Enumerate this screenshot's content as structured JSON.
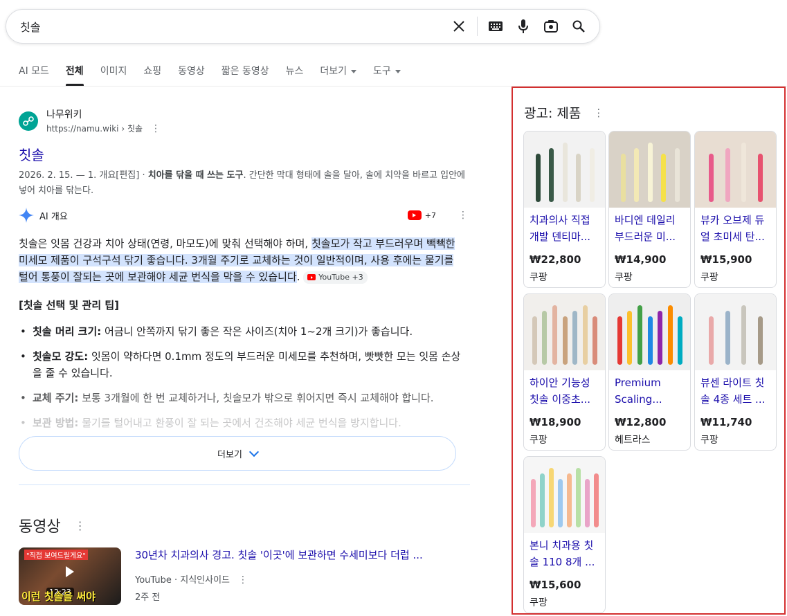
{
  "search": {
    "query": "칫솔",
    "icons": [
      "close-icon",
      "keyboard-icon",
      "mic-icon",
      "lens-icon",
      "search-icon"
    ]
  },
  "tabs": [
    {
      "label": "AI 모드",
      "active": false
    },
    {
      "label": "전체",
      "active": true
    },
    {
      "label": "이미지",
      "active": false
    },
    {
      "label": "쇼핑",
      "active": false
    },
    {
      "label": "동영상",
      "active": false
    },
    {
      "label": "짧은 동영상",
      "active": false
    },
    {
      "label": "뉴스",
      "active": false
    },
    {
      "label": "더보기",
      "active": false,
      "dropdown": true
    },
    {
      "label": "도구",
      "active": false,
      "dropdown": true
    }
  ],
  "result": {
    "site_name": "나무위키",
    "site_url": "https://namu.wiki › 칫솔",
    "title": "칫솔",
    "snippet_date": "2026. 2. 15. — 1. 개요[편집] · ",
    "snippet_bold": "치아를 닦을 때 쓰는 도구",
    "snippet_rest": ". 간단한 막대 형태에 솔을 달아, 솔에 치약을 바르고 입안에 넣어 치아를 닦는다."
  },
  "ai_overview": {
    "label": "AI 개요",
    "source_count": "+7",
    "intro": "칫솔은 잇몸 건강과 치아 상태(연령, 마모도)에 맞춰 선택해야 하며, ",
    "highlight": "칫솔모가 작고 부드러우며 빽빽한 미세모 제품이 구석구석 닦기 좋습니다. 3개월 주기로 교체하는 것이 일반적이며, 사용 후에는 물기를 털어 통풍이 잘되는 곳에 보관해야 세균 번식을 막을 수 있습니다",
    "trail": ".",
    "cite": "YouTube +3",
    "tips_title": "[칫솔 선택 및 관리 팁]",
    "tips": [
      {
        "bold": "칫솔 머리 크기:",
        "text": " 어금니 안쪽까지 닦기 좋은 작은 사이즈(치아 1~2개 크기)가 좋습니다."
      },
      {
        "bold": "칫솔모 강도:",
        "text": " 잇몸이 약하다면 0.1mm 정도의 부드러운 미세모를 추천하며, 빳빳한 모는 잇몸 손상을 줄 수 있습니다."
      },
      {
        "bold": "교체 주기:",
        "text": " 보통 3개월에 한 번 교체하거나, 칫솔모가 밖으로 휘어지면 즉시 교체해야 합니다."
      },
      {
        "bold": "보관 방법:",
        "text": " 물기를 털어내고 환풍이 잘 되는 곳에서 건조해야 세균 번식을 방지합니다."
      }
    ],
    "more_label": "더보기"
  },
  "videos": {
    "heading": "동영상",
    "items": [
      {
        "title": "30년차 치과의사 경고. 칫솔 '이곳'에 보관하면 수세미보다 더럽 ...",
        "source": "YouTube · 지식인사이드",
        "age": "2주 전",
        "duration": "12:23",
        "thumb_top": "\"직접 보여드릴게요\"",
        "thumb_bottom": "이런 칫솔을 써야"
      }
    ]
  },
  "ads": {
    "title": "광고: 제품",
    "products": [
      {
        "name": "치과의사 직접 개발 덴티마...",
        "price": "₩22,800",
        "seller": "쿠팡",
        "bg": "#f2f2f2",
        "colors": [
          "#2e4a3a",
          "#3a5a48",
          "#e9e6dc",
          "#d9d4c6",
          "#f0ede4"
        ]
      },
      {
        "name": "바디엔 데일리 부드러운 미...",
        "price": "₩14,900",
        "seller": "쿠팡",
        "bg": "#d9d2c7",
        "colors": [
          "#e9dfa0",
          "#f3e9b5",
          "#f7f3d6",
          "#f5e14a",
          "#e9e4d8"
        ]
      },
      {
        "name": "뷰카 오브제 듀얼 초미세 탄...",
        "price": "₩15,900",
        "seller": "쿠팡",
        "bg": "#e8ddd2",
        "colors": [
          "#e85a8a",
          "#f0a6c0",
          "#efe6da",
          "#e7526f"
        ]
      },
      {
        "name": "하이안 기능성 칫솔 이중초...",
        "price": "₩18,900",
        "seller": "쿠팡",
        "bg": "#f1efec",
        "colors": [
          "#d4c8b8",
          "#b7c9a6",
          "#e3b4a1",
          "#c9a37e",
          "#9fb7c7",
          "#e8cfa2",
          "#d98c7a"
        ]
      },
      {
        "name": "Premium Scaling...",
        "price": "₩12,800",
        "seller": "헤트라스",
        "bg": "#eeeeee",
        "colors": [
          "#e53935",
          "#fbc02d",
          "#43a047",
          "#1e88e5",
          "#8e24aa",
          "#fb8c00",
          "#00acc1"
        ]
      },
      {
        "name": "뷰센 라이트 칫솔 4종 세트 ...",
        "price": "₩11,740",
        "seller": "쿠팡",
        "bg": "#f3f3f3",
        "colors": [
          "#e9a9a9",
          "#9bb3c9",
          "#c9c6bd",
          "#a69a88"
        ]
      },
      {
        "name": "본니 치과용 칫솔 110 8개 ...",
        "price": "₩15,600",
        "seller": "쿠팡",
        "bg": "#f6f6f6",
        "colors": [
          "#f4a7b9",
          "#8fd3c9",
          "#f7d774",
          "#9ec9ef",
          "#f6b98f",
          "#b8e0a6",
          "#e9a4c8",
          "#f28c8c"
        ]
      }
    ]
  }
}
